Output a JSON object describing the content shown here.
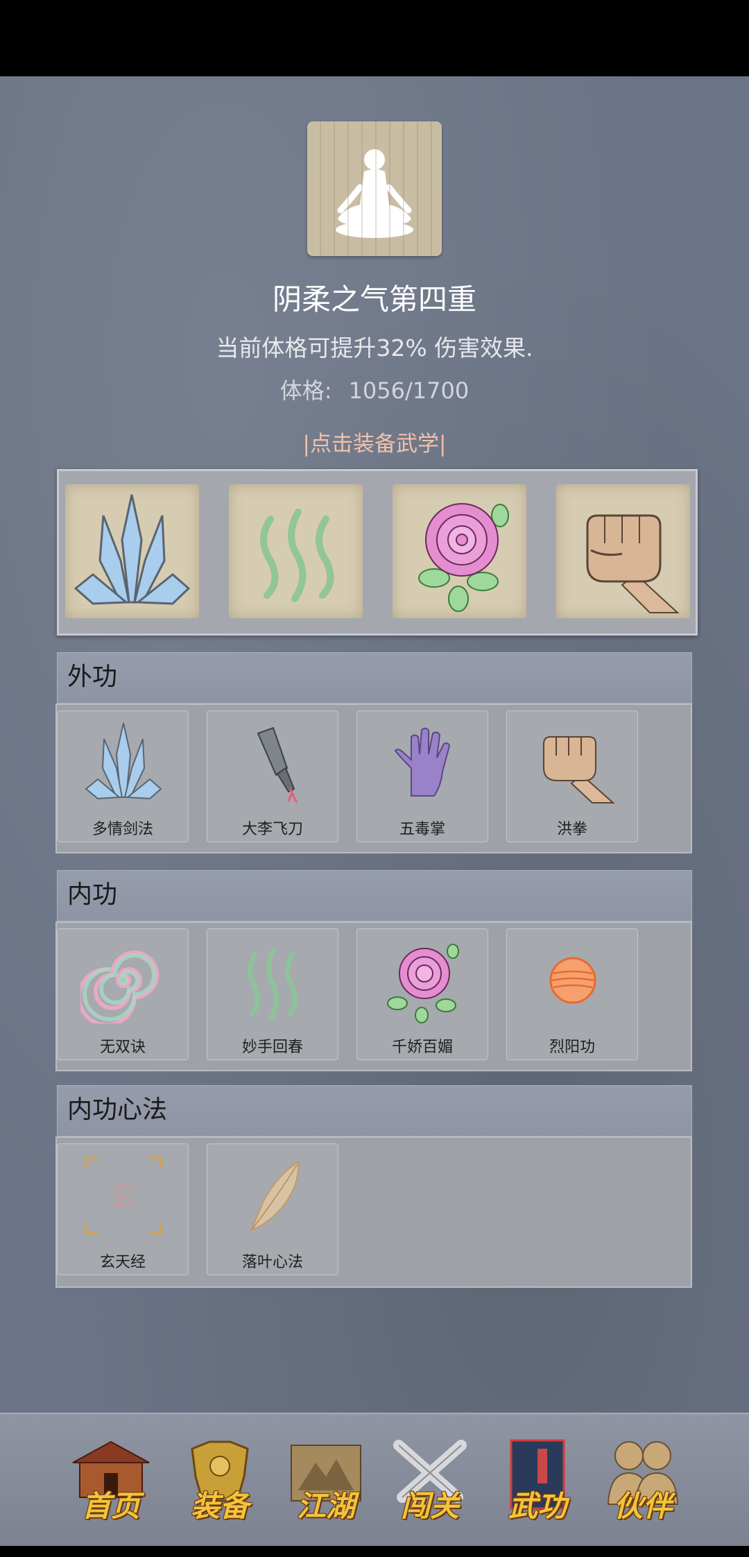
{
  "technique": {
    "title": "阴柔之气第四重",
    "description": "当前体格可提升32% 伤害效果.",
    "stat_label": "体格:",
    "stat_value": "1056/1700",
    "equip_link": "|点击装备武学|"
  },
  "sections": [
    {
      "title": "外功",
      "items": [
        "多情剑法",
        "大李飞刀",
        "五毒掌",
        "洪拳"
      ]
    },
    {
      "title": "内功",
      "items": [
        "无双诀",
        "妙手回春",
        "千娇百媚",
        "烈阳功"
      ]
    },
    {
      "title": "内功心法",
      "items": [
        "玄天经",
        "落叶心法"
      ]
    }
  ],
  "xuan_glyph": "玄",
  "nav": [
    "首页",
    "装备",
    "江湖",
    "闯关",
    "武功",
    "伙伴"
  ],
  "colors": {
    "accent_link": "#f2c1a9",
    "nav_label": "#f3c43a",
    "background": "#6b7486"
  }
}
